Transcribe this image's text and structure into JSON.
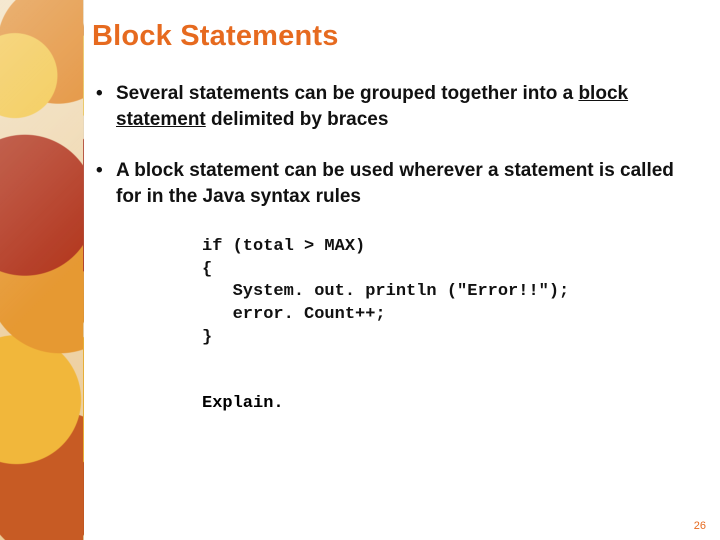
{
  "title": "Block Statements",
  "bullets": [
    {
      "pre": "Several statements can be grouped together into a ",
      "term": "block statement",
      "post": " delimited by braces"
    },
    {
      "pre": "A block statement can be used wherever a statement is called for in the Java syntax rules",
      "term": "",
      "post": ""
    }
  ],
  "code": "if (total > MAX)\n{\n   System. out. println (\"Error!!\");\n   error. Count++;\n}",
  "explain": "Explain.",
  "page_number": "26"
}
